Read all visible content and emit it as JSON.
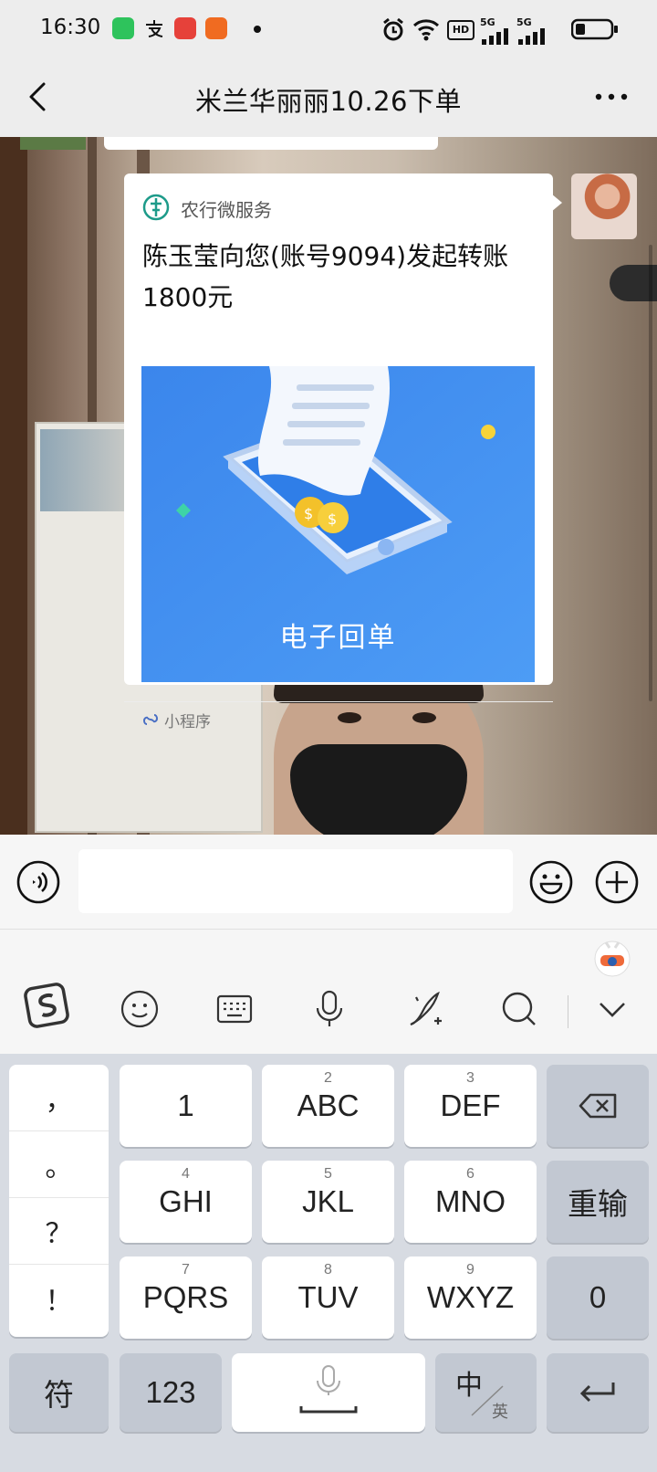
{
  "status_bar": {
    "time": "16:30",
    "network_badges": [
      "HD",
      "5G",
      "5G"
    ]
  },
  "nav": {
    "title": "米兰华丽丽10.26下单"
  },
  "card": {
    "source": "农行微服务",
    "title": "陈玉莹向您(账号9094)发起转账1800元",
    "image_label": "电子回单",
    "footer": "小程序"
  },
  "colors": {
    "keyboard_bg": "#d7dbe2",
    "card_image_blue": "#3d8ef0",
    "nav_bg": "#ededed"
  },
  "keyboard": {
    "punctuation": [
      "，",
      "。",
      "？",
      "！"
    ],
    "row1": [
      {
        "main": "1",
        "sub": ""
      },
      {
        "main": "ABC",
        "sub": "2"
      },
      {
        "main": "DEF",
        "sub": "3"
      }
    ],
    "row2": [
      {
        "main": "GHI",
        "sub": "4"
      },
      {
        "main": "JKL",
        "sub": "5"
      },
      {
        "main": "MNO",
        "sub": "6"
      }
    ],
    "row3": [
      {
        "main": "PQRS",
        "sub": "7"
      },
      {
        "main": "TUV",
        "sub": "8"
      },
      {
        "main": "WXYZ",
        "sub": "9"
      }
    ],
    "retype": "重输",
    "zero": "0",
    "symbol": "符",
    "numbers": "123",
    "lang_main": "中",
    "lang_sub": "英"
  }
}
